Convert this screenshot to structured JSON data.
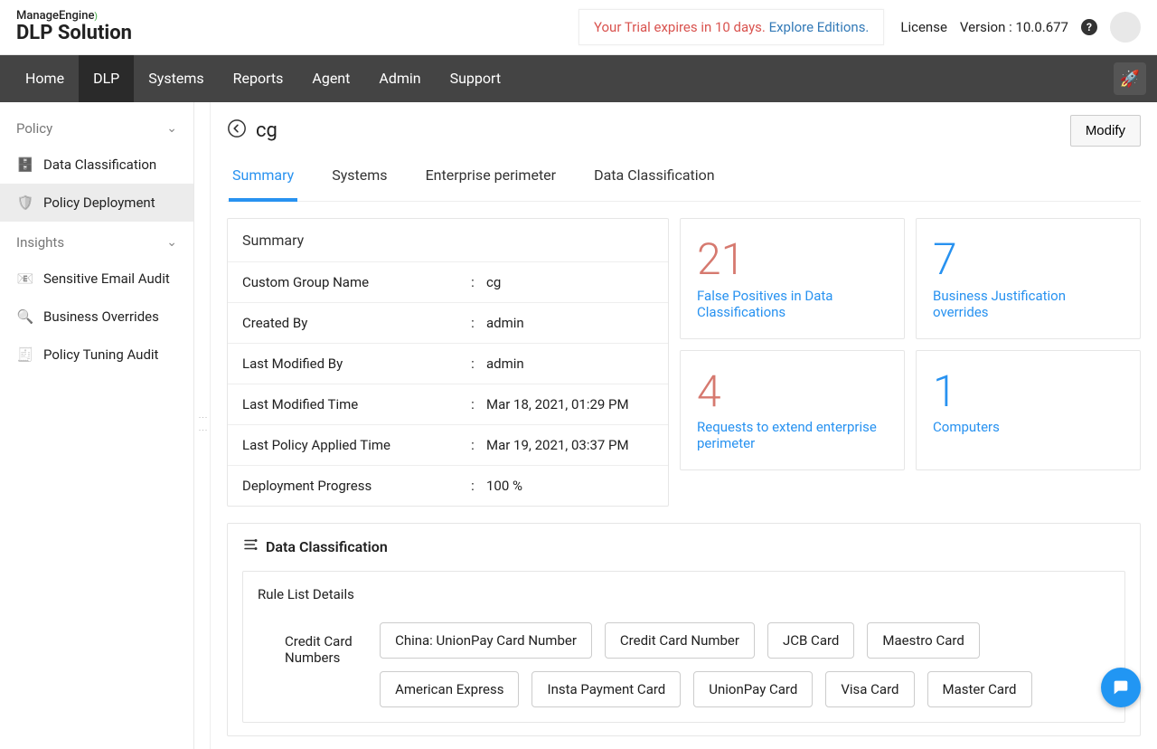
{
  "brand": {
    "top": "ManageEngine",
    "main": "DLP Solution"
  },
  "trial": {
    "message": "Your Trial expires in 10 days.",
    "link": "Explore Editions."
  },
  "license": {
    "label": "License",
    "version_label": "Version :",
    "version": "10.0.677"
  },
  "nav": {
    "items": [
      "Home",
      "DLP",
      "Systems",
      "Reports",
      "Agent",
      "Admin",
      "Support"
    ],
    "active": "DLP"
  },
  "sidebar": {
    "groups": [
      {
        "label": "Policy",
        "items": [
          {
            "label": "Data Classification",
            "icon": "🗄️"
          },
          {
            "label": "Policy Deployment",
            "icon": "🛡️",
            "active": true
          }
        ]
      },
      {
        "label": "Insights",
        "items": [
          {
            "label": "Sensitive Email Audit",
            "icon": "📧"
          },
          {
            "label": "Business Overrides",
            "icon": "🔍"
          },
          {
            "label": "Policy Tuning Audit",
            "icon": "🧾"
          }
        ]
      }
    ]
  },
  "page": {
    "title": "cg",
    "modify": "Modify"
  },
  "tabs": {
    "items": [
      "Summary",
      "Systems",
      "Enterprise perimeter",
      "Data Classification"
    ],
    "active": "Summary"
  },
  "summary": {
    "header": "Summary",
    "rows": [
      {
        "k": "Custom Group Name",
        "v": "cg"
      },
      {
        "k": "Created By",
        "v": "admin"
      },
      {
        "k": "Last Modified By",
        "v": "admin"
      },
      {
        "k": "Last Modified Time",
        "v": "Mar 18, 2021, 01:29 PM"
      },
      {
        "k": "Last Policy Applied Time",
        "v": "Mar 19, 2021, 03:37 PM"
      },
      {
        "k": "Deployment Progress",
        "v": "100 %"
      }
    ]
  },
  "stats": [
    {
      "value": "21",
      "label": "False Positives in Data Classifications",
      "color": "red"
    },
    {
      "value": "7",
      "label": "Business Justification overrides",
      "color": "blue"
    },
    {
      "value": "4",
      "label": "Requests to extend enterprise perimeter",
      "color": "red"
    },
    {
      "value": "1",
      "label": "Computers",
      "color": "blue"
    }
  ],
  "dc": {
    "header": "Data Classification",
    "rules_header": "Rule List Details",
    "category": "Credit Card Numbers",
    "chips": [
      "China: UnionPay Card Number",
      "Credit Card Number",
      "JCB Card",
      "Maestro Card",
      "American Express",
      "Insta Payment Card",
      "UnionPay Card",
      "Visa Card",
      "Master Card"
    ]
  }
}
